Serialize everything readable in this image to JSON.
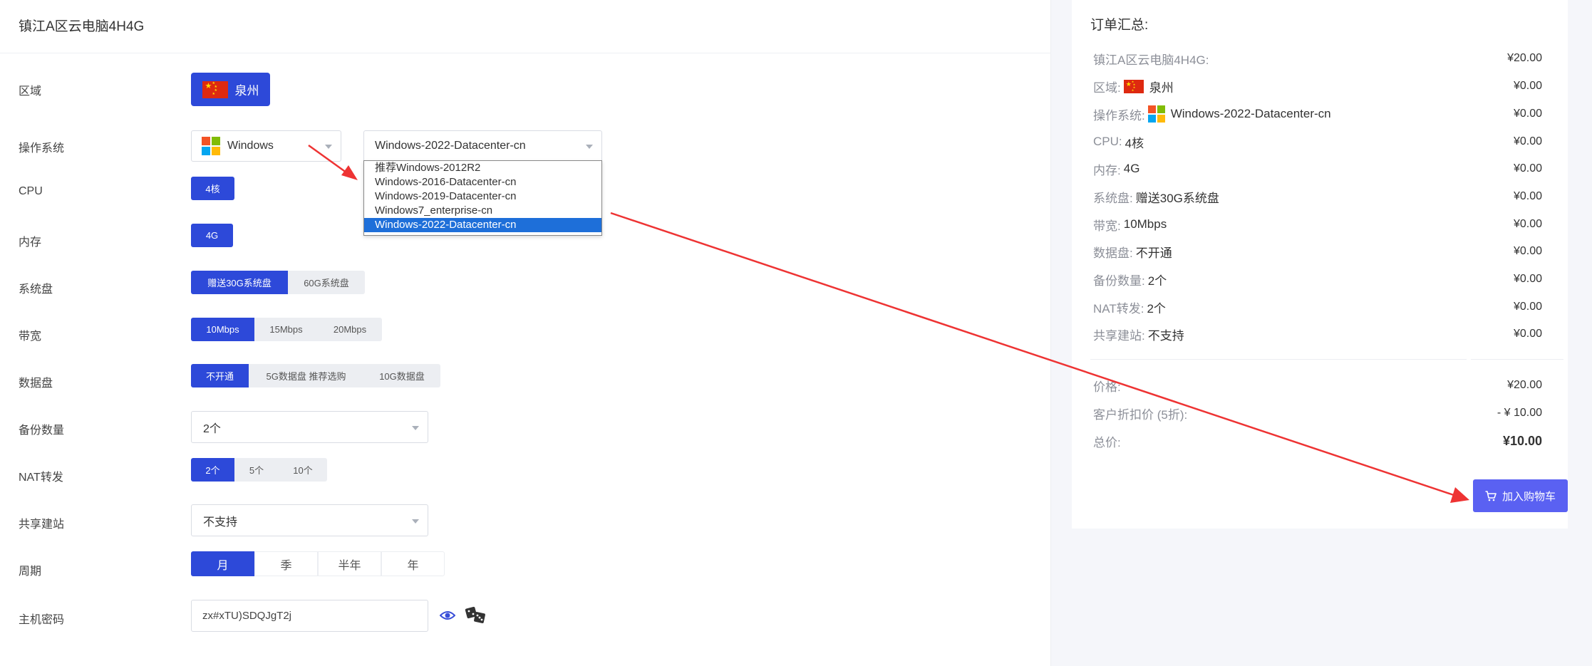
{
  "product": {
    "title": "镇江A区云电脑4H4G"
  },
  "config": {
    "region": {
      "label": "区域",
      "value": "泉州"
    },
    "os": {
      "label": "操作系统",
      "family": "Windows",
      "version": "Windows-2022-Datacenter-cn",
      "options": [
        "推荐Windows-2012R2",
        "Windows-2016-Datacenter-cn",
        "Windows-2019-Datacenter-cn",
        "Windows7_enterprise-cn",
        "Windows-2022-Datacenter-cn"
      ]
    },
    "cpu": {
      "label": "CPU",
      "options": [
        "4核"
      ]
    },
    "memory": {
      "label": "内存",
      "options": [
        "4G"
      ]
    },
    "system_disk": {
      "label": "系统盘",
      "options": [
        "赠送30G系统盘",
        "60G系统盘"
      ]
    },
    "bandwidth": {
      "label": "带宽",
      "options": [
        "10Mbps",
        "15Mbps",
        "20Mbps"
      ]
    },
    "data_disk": {
      "label": "数据盘",
      "options": [
        "不开通",
        "5G数据盘 推荐选购",
        "10G数据盘"
      ]
    },
    "backup": {
      "label": "备份数量",
      "value": "2个"
    },
    "nat": {
      "label": "NAT转发",
      "options": [
        "2个",
        "5个",
        "10个"
      ]
    },
    "site": {
      "label": "共享建站",
      "value": "不支持"
    },
    "period": {
      "label": "周期",
      "options": [
        "月",
        "季",
        "半年",
        "年"
      ]
    },
    "password": {
      "label": "主机密码",
      "value": "zx#xTU)SDQJgT2j"
    }
  },
  "summary": {
    "title": "订单汇总:",
    "rows": [
      {
        "key": "镇江A区云电脑4H4G:",
        "value": "",
        "price": "¥20.00"
      },
      {
        "key": "区域:",
        "value": "泉州",
        "price": "¥0.00"
      },
      {
        "key": "操作系统:",
        "value": "Windows-2022-Datacenter-cn",
        "price": "¥0.00"
      },
      {
        "key": "CPU:",
        "value": "4核",
        "price": "¥0.00"
      },
      {
        "key": "内存:",
        "value": "4G",
        "price": "¥0.00"
      },
      {
        "key": "系统盘:",
        "value": "赠送30G系统盘",
        "price": "¥0.00"
      },
      {
        "key": "带宽:",
        "value": "10Mbps",
        "price": "¥0.00"
      },
      {
        "key": "数据盘:",
        "value": "不开通",
        "price": "¥0.00"
      },
      {
        "key": "备份数量:",
        "value": "2个",
        "price": "¥0.00"
      },
      {
        "key": "NAT转发:",
        "value": "2个",
        "price": "¥0.00"
      },
      {
        "key": "共享建站:",
        "value": "不支持",
        "price": "¥0.00"
      }
    ],
    "price_label": "价格:",
    "price": "¥20.00",
    "discount_label": "客户折扣价 (5折):",
    "discount": "- ¥ 10.00",
    "total_label": "总价:",
    "total": "¥10.00",
    "cart_button": "加入购物车"
  },
  "colors": {
    "primary": "#2d49d9",
    "cart": "#5a61f2",
    "arrow": "#ee3333",
    "selected_option": "#1e6fd9"
  }
}
